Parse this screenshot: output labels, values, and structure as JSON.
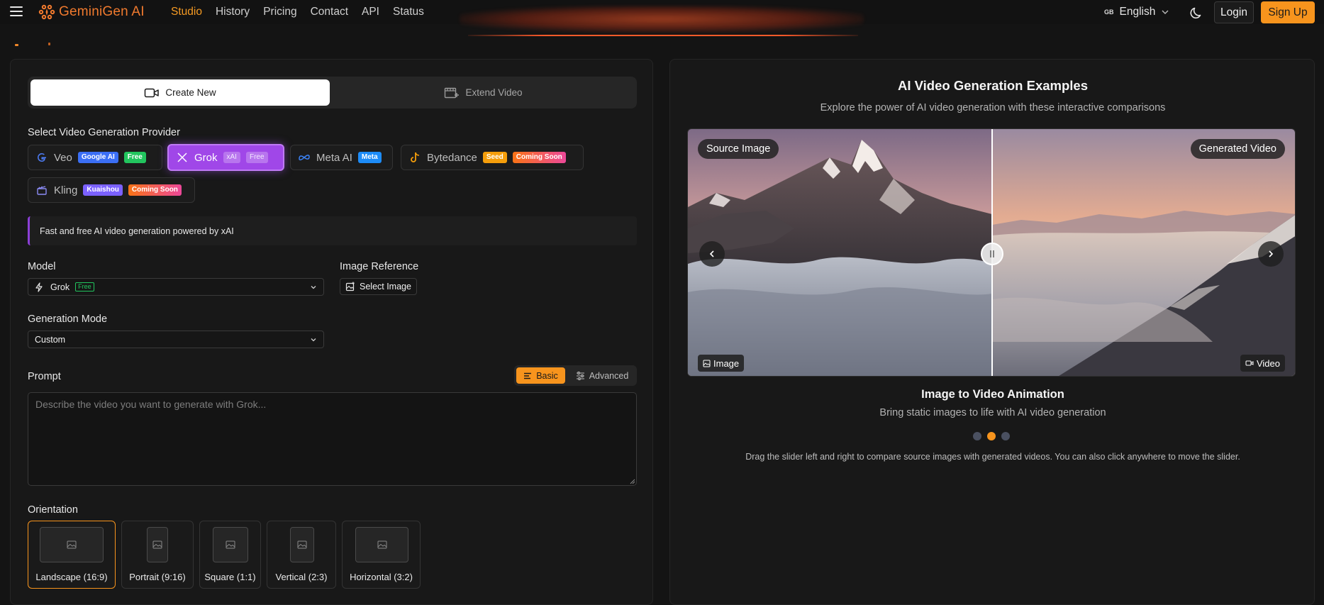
{
  "header": {
    "logo_text": "GeminiGen AI",
    "nav": [
      {
        "label": "Studio",
        "active": true
      },
      {
        "label": "History",
        "active": false
      },
      {
        "label": "Pricing",
        "active": false
      },
      {
        "label": "Contact",
        "active": false
      },
      {
        "label": "API",
        "active": false
      },
      {
        "label": "Status",
        "active": false
      }
    ],
    "language_flag": "GB",
    "language": "English",
    "login_label": "Login",
    "signup_label": "Sign Up",
    "accent_color": "#f7941d"
  },
  "studio": {
    "tabs": {
      "create_new": "Create New",
      "extend_video": "Extend Video"
    },
    "provider_section_label": "Select Video Generation Provider",
    "providers": [
      {
        "name": "Veo",
        "badges": [
          "Google AI",
          "Free"
        ],
        "selected": false,
        "icon": "google-g-icon"
      },
      {
        "name": "Grok",
        "badges": [
          "xAI",
          "Free"
        ],
        "selected": true,
        "icon": "x-logo-icon"
      },
      {
        "name": "Meta AI",
        "badges": [
          "Meta"
        ],
        "selected": false,
        "icon": "meta-infinity-icon"
      },
      {
        "name": "Bytedance",
        "badges": [
          "Seed",
          "Coming Soon"
        ],
        "selected": false,
        "icon": "tiktok-note-icon"
      },
      {
        "name": "Kling",
        "badges": [
          "Kuaishou",
          "Coming Soon"
        ],
        "selected": false,
        "icon": "clapper-icon"
      }
    ],
    "provider_info": "Fast and free AI video generation powered by xAI",
    "model_label": "Model",
    "model_value": "Grok",
    "model_tag": "Free",
    "image_reference_label": "Image Reference",
    "select_image_label": "Select Image",
    "generation_mode_label": "Generation Mode",
    "generation_mode_value": "Custom",
    "prompt_label": "Prompt",
    "prompt_mode_basic": "Basic",
    "prompt_mode_advanced": "Advanced",
    "prompt_placeholder": "Describe the video you want to generate with Grok...",
    "prompt_value": "",
    "orientation_label": "Orientation",
    "orientations": [
      {
        "label": "Landscape (16:9)",
        "selected": true
      },
      {
        "label": "Portrait (9:16)",
        "selected": false
      },
      {
        "label": "Square (1:1)",
        "selected": false
      },
      {
        "label": "Vertical (2:3)",
        "selected": false
      },
      {
        "label": "Horizontal (3:2)",
        "selected": false
      }
    ]
  },
  "examples": {
    "title": "AI Video Generation Examples",
    "subtitle": "Explore the power of AI video generation with these interactive comparisons",
    "left_tag": "Source Image",
    "right_tag": "Generated Video",
    "left_chip": "Image",
    "right_chip": "Video",
    "slider_position": 0.5,
    "caption_title": "Image to Video Animation",
    "caption_sub": "Bring static images to life with AI video generation",
    "active_slide": 2,
    "total_slides": 3,
    "hint": "Drag the slider left and right to compare source images with generated videos. You can also click anywhere to move the slider."
  }
}
